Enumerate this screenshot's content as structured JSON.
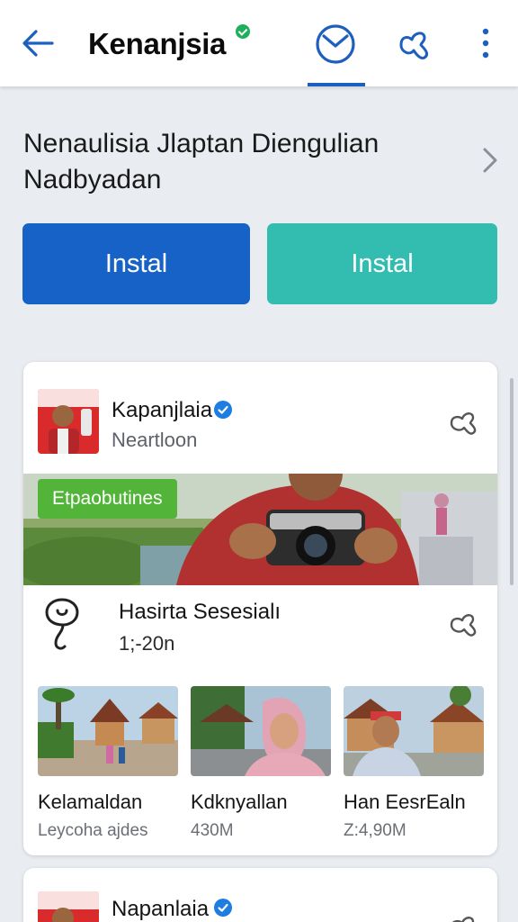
{
  "topbar": {
    "title": "Kenanjsia",
    "icons": [
      "back-arrow-icon",
      "clock-tab-icon",
      "share-icon",
      "more-vert-icon"
    ]
  },
  "headline": "Nenaulisia Jlaptan Diengulian Nadbyadan",
  "buttons": {
    "primary_label": "Instal",
    "secondary_label": "Instal"
  },
  "colors": {
    "accent": "#1d5fbf",
    "primary": "#1662c6",
    "secondary": "#33bcb0",
    "tag": "#52b53a",
    "verified": "#1faf5c"
  },
  "card": {
    "publisher": "Kapanjlaia",
    "publisher_sub": "Neartloon",
    "photo_tag": "Etpaobutines",
    "info_title": "Hasirta Sesesialı",
    "info_sub": "1;-20n",
    "items": [
      {
        "title": "Kelamaldan",
        "sub": "Leycoha ajdes"
      },
      {
        "title": "Kdknyallan",
        "sub": "430M"
      },
      {
        "title": "Han EesrEaln",
        "sub": "Z:4,90M"
      }
    ]
  },
  "card2": {
    "publisher": "Napanlaia"
  }
}
